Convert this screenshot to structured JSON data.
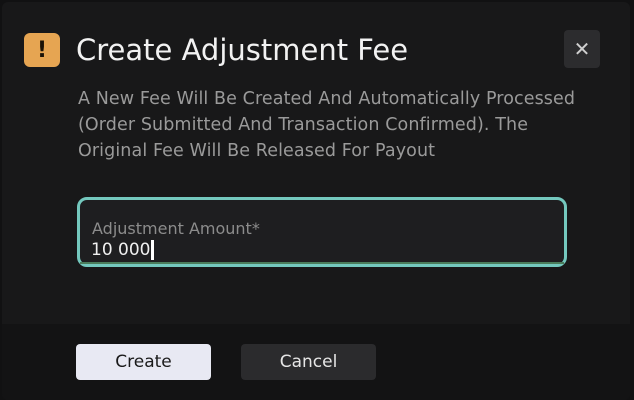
{
  "dialog": {
    "title": "Create Adjustment Fee",
    "warning_glyph": "!",
    "close_glyph": "✕",
    "description": "A New Fee Will Be Created And Automatically Processed (Order Submitted And Transaction Confirmed). The Original Fee Will Be Released For Payout"
  },
  "adjustment_amount": {
    "label": "Adjustment Amount*",
    "value": "10 000"
  },
  "actions": {
    "create_label": "Create",
    "cancel_label": "Cancel"
  },
  "colors": {
    "warning_badge": "#e6a552",
    "field_border": "#74c8be",
    "primary_button": "#e8e9f3",
    "secondary_button": "#2b2b2d"
  },
  "icons": {
    "warning": "exclamation-icon",
    "close": "close-icon"
  }
}
